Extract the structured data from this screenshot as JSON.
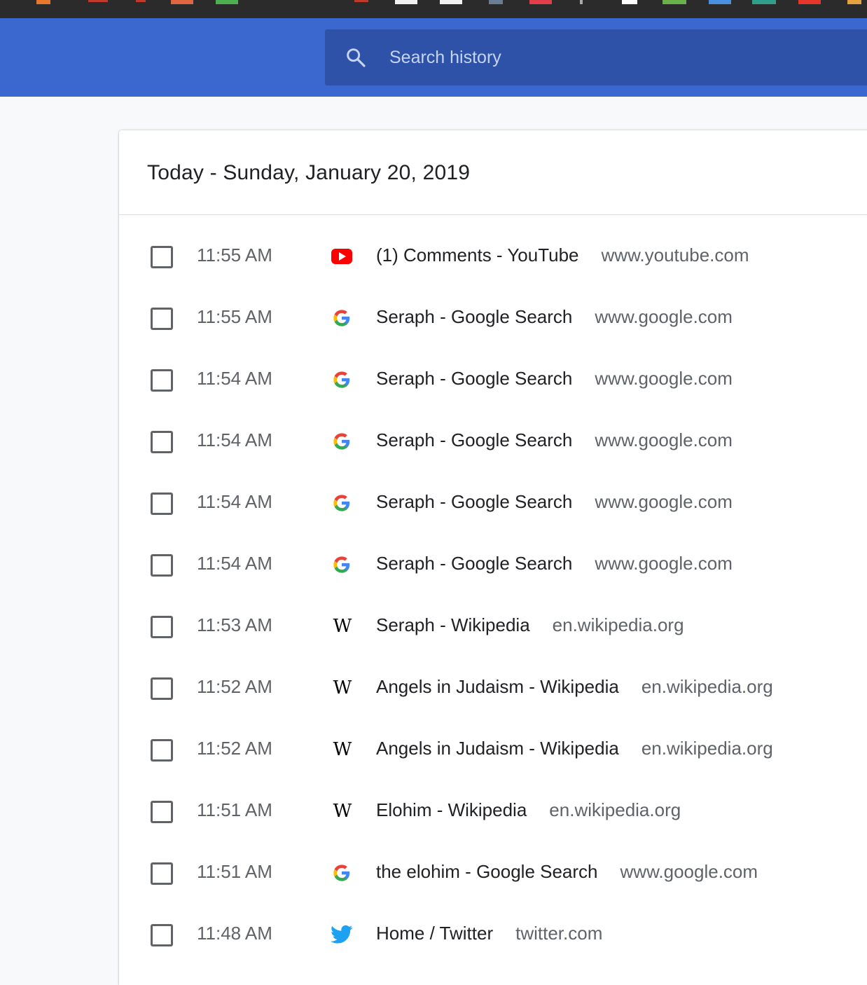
{
  "search": {
    "placeholder": "Search history",
    "value": ""
  },
  "history": {
    "date_heading": "Today - Sunday, January 20, 2019",
    "entries": [
      {
        "time": "11:55 AM",
        "icon": "youtube-icon",
        "title": "(1) Comments - YouTube",
        "domain": "www.youtube.com"
      },
      {
        "time": "11:55 AM",
        "icon": "google-icon",
        "title": "Seraph - Google Search",
        "domain": "www.google.com"
      },
      {
        "time": "11:54 AM",
        "icon": "google-icon",
        "title": "Seraph - Google Search",
        "domain": "www.google.com"
      },
      {
        "time": "11:54 AM",
        "icon": "google-icon",
        "title": "Seraph - Google Search",
        "domain": "www.google.com"
      },
      {
        "time": "11:54 AM",
        "icon": "google-icon",
        "title": "Seraph - Google Search",
        "domain": "www.google.com"
      },
      {
        "time": "11:54 AM",
        "icon": "google-icon",
        "title": "Seraph - Google Search",
        "domain": "www.google.com"
      },
      {
        "time": "11:53 AM",
        "icon": "wikipedia-icon",
        "title": "Seraph - Wikipedia",
        "domain": "en.wikipedia.org"
      },
      {
        "time": "11:52 AM",
        "icon": "wikipedia-icon",
        "title": "Angels in Judaism - Wikipedia",
        "domain": "en.wikipedia.org"
      },
      {
        "time": "11:52 AM",
        "icon": "wikipedia-icon",
        "title": "Angels in Judaism - Wikipedia",
        "domain": "en.wikipedia.org"
      },
      {
        "time": "11:51 AM",
        "icon": "wikipedia-icon",
        "title": "Elohim - Wikipedia",
        "domain": "en.wikipedia.org"
      },
      {
        "time": "11:51 AM",
        "icon": "google-icon",
        "title": "the elohim - Google Search",
        "domain": "www.google.com"
      },
      {
        "time": "11:48 AM",
        "icon": "twitter-icon",
        "title": "Home / Twitter",
        "domain": "twitter.com"
      }
    ]
  },
  "colors": {
    "toolbar": "#3b68cf",
    "search_box": "#2d52a8",
    "page_background": "#f8f9fa",
    "youtube_red": "#ff0000",
    "twitter_blue": "#1da1f2"
  }
}
